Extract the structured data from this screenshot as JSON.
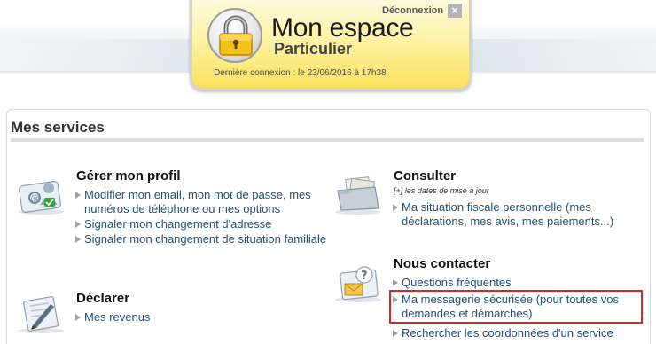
{
  "espace": {
    "title": "Mon espace",
    "subtitle": "Particulier",
    "logout_label": "Déconnexion",
    "logout_close": "×",
    "last_login": "Dernière connexion : le 23/06/2016 à 17h38",
    "lock_icon": "padlock-icon"
  },
  "services": {
    "heading": "Mes services",
    "gerer": {
      "title": "Gérer mon profil",
      "icon": "profile-card-icon",
      "links": [
        "Modifier mon email, mon mot de passe, mes numéros de téléphone ou mes options",
        "Signaler mon changement d'adresse",
        "Signaler mon changement de situation familiale"
      ]
    },
    "declarer": {
      "title": "Déclarer",
      "icon": "declaration-pen-icon",
      "links": [
        "Mes revenus"
      ]
    },
    "consulter": {
      "title": "Consulter",
      "icon": "folder-documents-icon",
      "note": "[+] les dates de mise à jour",
      "links": [
        "Ma situation fiscale personnelle (mes déclarations, mes avis, mes paiements...)"
      ]
    },
    "contact": {
      "title": "Nous contacter",
      "icon": "envelope-question-icon",
      "links": [
        "Questions fréquentes",
        "Ma messagerie sécurisée (pour toutes vos demandes et démarches)",
        "Rechercher les coordonnées d'un service"
      ],
      "highlighted_index": 1
    }
  },
  "colors": {
    "link": "#1f4f7a",
    "highlight_border": "#d92626",
    "card_yellow": "#fbe25c"
  }
}
